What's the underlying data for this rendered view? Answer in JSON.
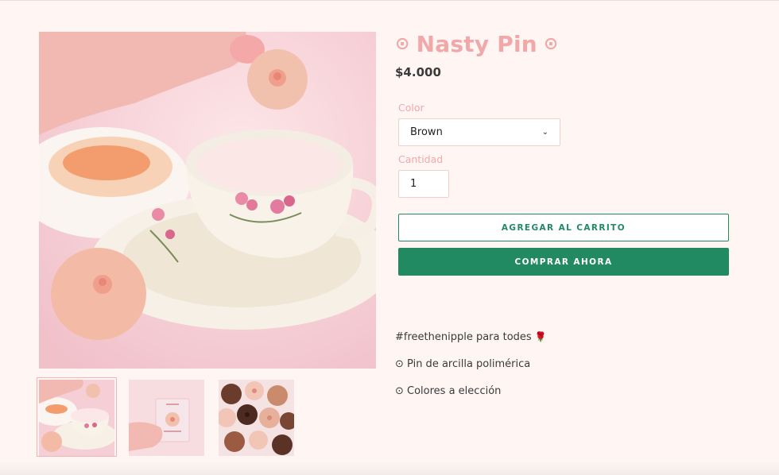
{
  "product": {
    "title": "Nasty Pin",
    "title_prefix": "⊙",
    "title_suffix": "⊙",
    "price": "$4.000"
  },
  "form": {
    "color_label": "Color",
    "color_value": "Brown",
    "quantity_label": "Cantidad",
    "quantity_value": "1",
    "add_to_cart": "AGREGAR AL CARRITO",
    "buy_now": "COMPRAR AHORA"
  },
  "description": {
    "line1": "#freethenipple para todes",
    "line1_emoji": "🌹",
    "line2": "⊙ Pin de arcilla polimérica",
    "line3": "⊙ Colores a elección"
  },
  "gallery": {
    "thumbnails": [
      "teacup-photo",
      "card-package-photo",
      "assorted-pins-photo"
    ],
    "active_index": 0
  },
  "colors": {
    "accent_pink": "#f0a8a8",
    "button_green": "#228a63",
    "page_background": "#fff6f4"
  }
}
